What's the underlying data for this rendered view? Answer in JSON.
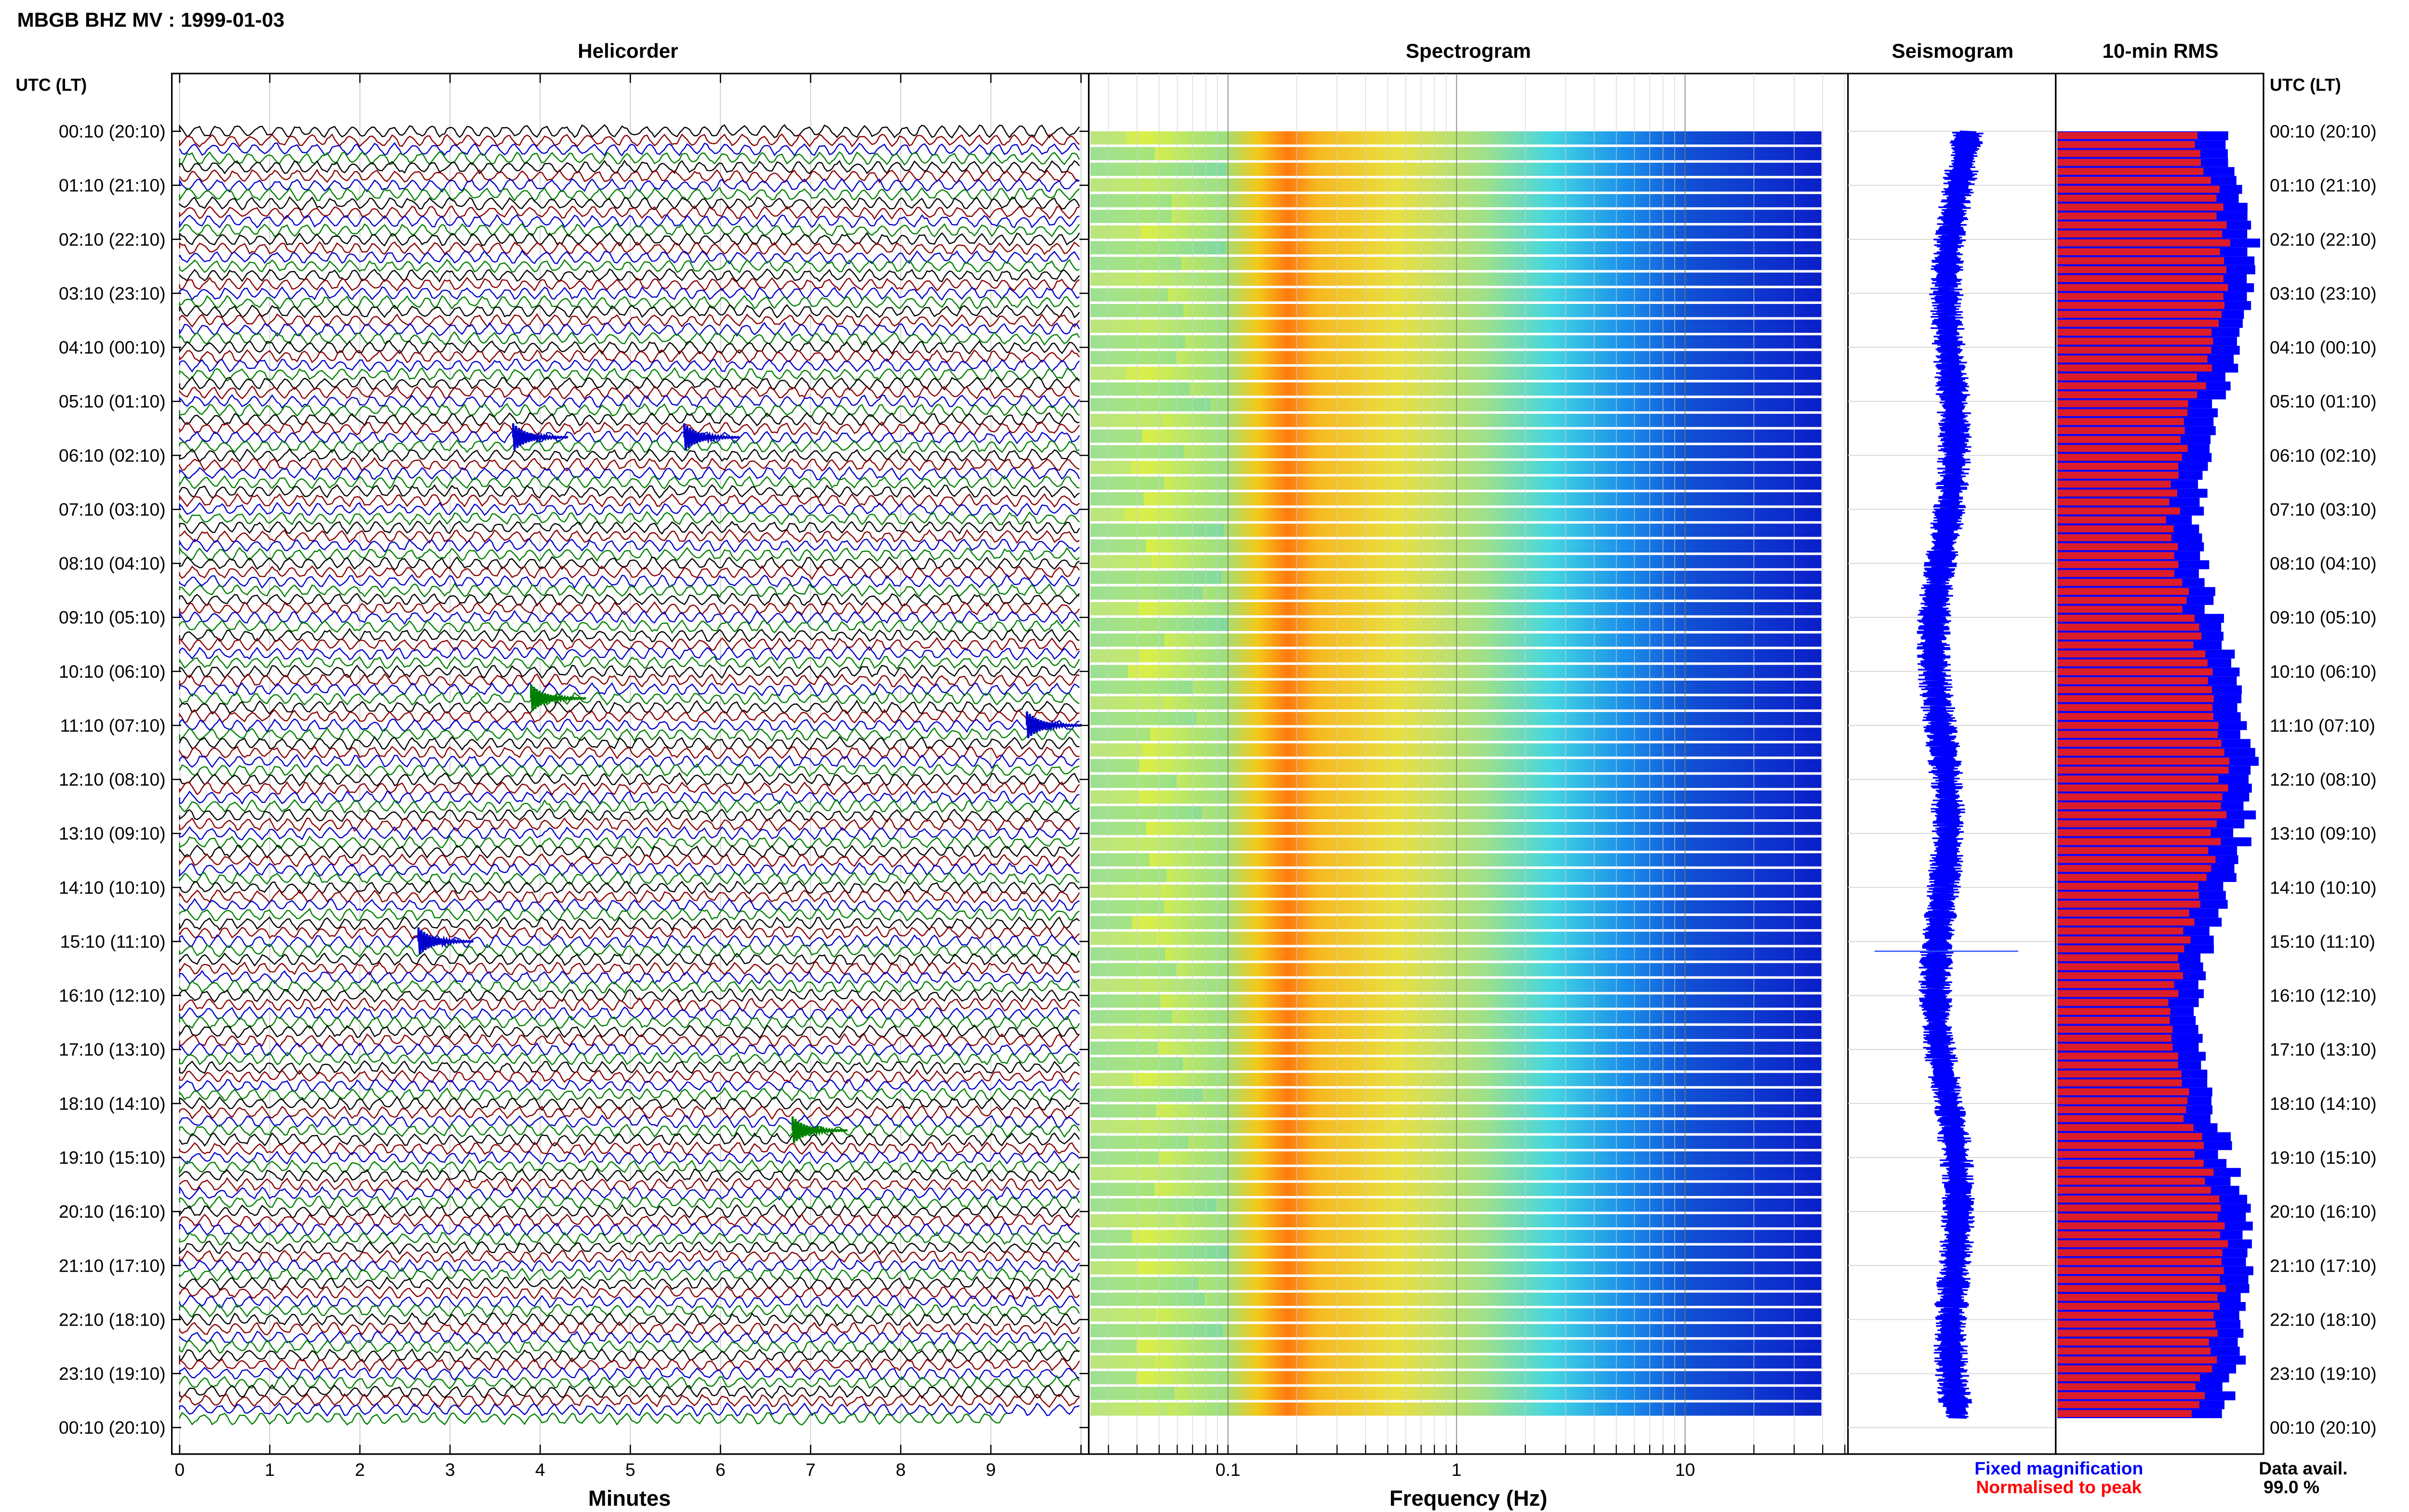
{
  "header": {
    "title": "MBGB BHZ MV : 1999-01-03"
  },
  "panels": {
    "helicorder": "Helicorder",
    "spectrogram": "Spectrogram",
    "seismogram": "Seismogram",
    "rms": "10-min RMS"
  },
  "axes": {
    "time_header": "UTC (LT)",
    "helicorder_xlabel": "Minutes",
    "spectrogram_xlabel": "Frequency (Hz)",
    "helicorder_ticks": [
      "0",
      "1",
      "2",
      "3",
      "4",
      "5",
      "6",
      "7",
      "8",
      "9"
    ],
    "spectrogram_ticks": [
      "0.1",
      "1",
      "10"
    ],
    "time_labels": [
      "00:10 (20:10)",
      "01:10 (21:10)",
      "02:10 (22:10)",
      "03:10 (23:10)",
      "04:10 (00:10)",
      "05:10 (01:10)",
      "06:10 (02:10)",
      "07:10 (03:10)",
      "08:10 (04:10)",
      "09:10 (05:10)",
      "10:10 (06:10)",
      "11:10 (07:10)",
      "12:10 (08:10)",
      "13:10 (09:10)",
      "14:10 (10:10)",
      "15:10 (11:10)",
      "16:10 (12:10)",
      "17:10 (13:10)",
      "18:10 (14:10)",
      "19:10 (15:10)",
      "20:10 (16:10)",
      "21:10 (17:10)",
      "22:10 (18:10)",
      "23:10 (19:10)",
      "00:10 (20:10)"
    ]
  },
  "legend": {
    "fixed": "Fixed magnification",
    "normalised": "Normalised to peak",
    "avail_label": "Data avail.",
    "avail_value": "99.0 %"
  },
  "colors": {
    "trace_cycle": [
      "#000000",
      "#8b0000",
      "#0000cc",
      "#008000"
    ],
    "fixed": "#0000ff",
    "normalised": "#ff0000",
    "rms_bar": "#dd1c2a",
    "rms_outline": "#0000ff"
  },
  "chart_data": [
    {
      "type": "helicorder",
      "title": "Helicorder",
      "xlabel": "Minutes",
      "xlim": [
        0,
        10
      ],
      "rows": 144,
      "row_minutes": 10,
      "events": [
        {
          "minute": 3.7,
          "row": 34
        },
        {
          "minute": 5.6,
          "row": 34
        },
        {
          "minute": 3.9,
          "row": 63
        },
        {
          "minute": 9.4,
          "row": 66
        },
        {
          "minute": 2.65,
          "row": 90
        },
        {
          "minute": 6.8,
          "row": 111
        }
      ]
    },
    {
      "type": "heatmap",
      "title": "Spectrogram",
      "xlabel": "Frequency (Hz)",
      "xscale": "log",
      "xlim": [
        0.025,
        50
      ],
      "peak_frequency_hz": 0.2,
      "colormap": "jet"
    },
    {
      "type": "line",
      "title": "Seismogram"
    },
    {
      "type": "bar",
      "title": "10-min RMS",
      "bars": 144,
      "series": [
        {
          "name": "Fixed magnification"
        },
        {
          "name": "Normalised to peak"
        }
      ]
    }
  ]
}
